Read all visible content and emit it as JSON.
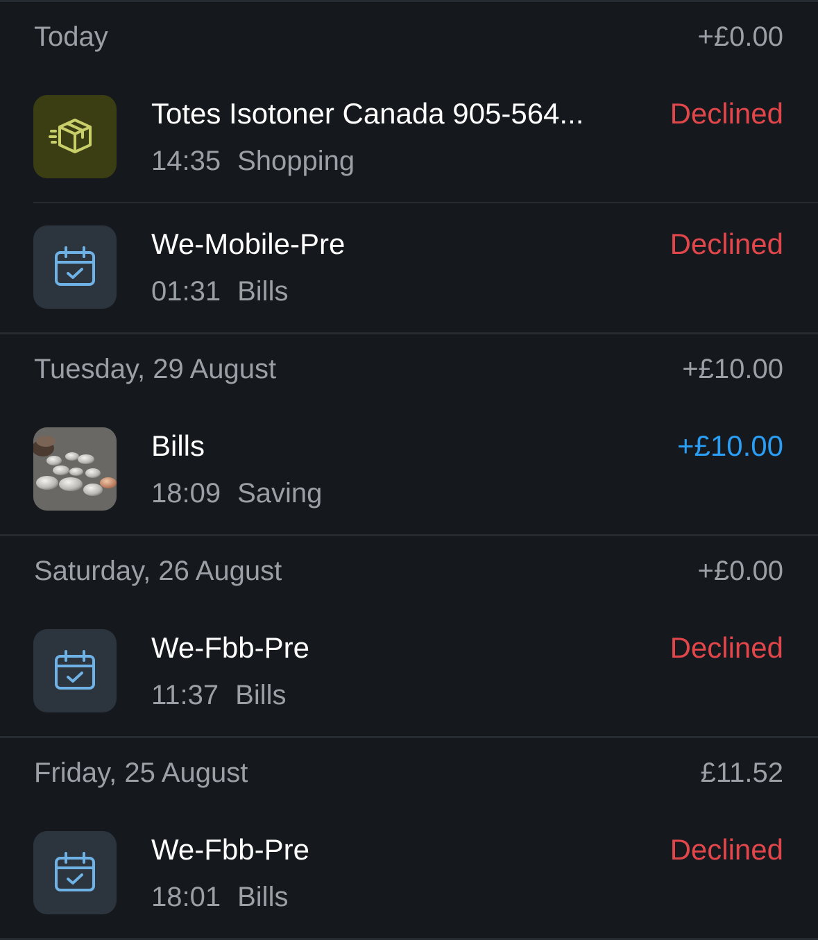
{
  "sections": [
    {
      "date": "Today",
      "total": "+£0.00",
      "transactions": [
        {
          "icon": "shopping-bag-icon",
          "name": "Totes Isotoner Canada 905-564...",
          "time": "14:35",
          "category": "Shopping",
          "amount": "Declined",
          "status": "declined"
        },
        {
          "icon": "calendar-check-icon",
          "name": "We-Mobile-Pre",
          "time": "01:31",
          "category": "Bills",
          "amount": "Declined",
          "status": "declined"
        }
      ]
    },
    {
      "date": "Tuesday, 29 August",
      "total": "+£10.00",
      "transactions": [
        {
          "icon": "coins-photo",
          "name": "Bills",
          "time": "18:09",
          "category": "Saving",
          "amount": "+£10.00",
          "status": "credit"
        }
      ]
    },
    {
      "date": "Saturday, 26 August",
      "total": "+£0.00",
      "transactions": [
        {
          "icon": "calendar-check-icon",
          "name": "We-Fbb-Pre",
          "time": "11:37",
          "category": "Bills",
          "amount": "Declined",
          "status": "declined"
        }
      ]
    },
    {
      "date": "Friday, 25 August",
      "total": "£11.52",
      "transactions": [
        {
          "icon": "calendar-check-icon",
          "name": "We-Fbb-Pre",
          "time": "18:01",
          "category": "Bills",
          "amount": "Declined",
          "status": "declined"
        }
      ]
    }
  ],
  "colors": {
    "background": "#15191e",
    "declined": "#e0464a",
    "credit": "#2a9ef5",
    "muted_text": "#9aa0a6",
    "shopping_icon_bg": "#3b3d12",
    "shopping_icon_fg": "#c8cf6a",
    "bills_icon_bg": "#2c343d",
    "bills_icon_fg": "#6fb2e6"
  }
}
